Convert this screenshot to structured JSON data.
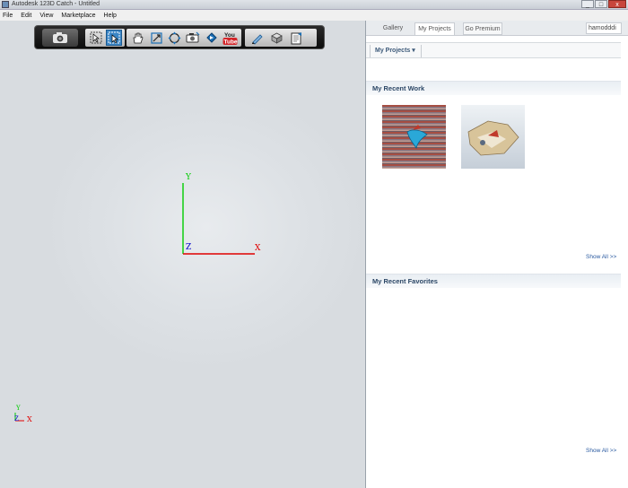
{
  "window": {
    "title": "Autodesk 123D Catch - Untitled",
    "buttons": {
      "minimize": "_",
      "maximize": "□",
      "close": "x"
    }
  },
  "menu": {
    "items": [
      "File",
      "Edit",
      "View",
      "Marketplace",
      "Help"
    ]
  },
  "toolbar": {
    "tools": [
      "camera-icon",
      "select-icon",
      "select-box-icon",
      "pan-icon",
      "zoom-icon",
      "orbit-icon",
      "camera-view-icon",
      "video-icon",
      "youtube-icon",
      "pen-icon",
      "export-icon",
      "notes-icon"
    ],
    "youtube_label_1": "You",
    "youtube_label_2": "Tube"
  },
  "viewport": {
    "axes": {
      "x": "X",
      "y": "Y",
      "z": "Z"
    },
    "mini_axes": {
      "x": "X",
      "y": "Y",
      "z": "Z"
    },
    "colors": {
      "x": "#e00000",
      "y": "#00cc00",
      "z": "#0000cc"
    }
  },
  "panel": {
    "tabs": {
      "gallery": "Gallery",
      "my_projects": "My Projects",
      "go_premium": "Go Premium"
    },
    "user": "hamodddi",
    "projects_dropdown": "My Projects ▾",
    "recent_work": {
      "heading": "My Recent Work",
      "show_all": "Show All >>"
    },
    "recent_favorites": {
      "heading": "My Recent Favorites",
      "show_all": "Show All >>"
    }
  }
}
